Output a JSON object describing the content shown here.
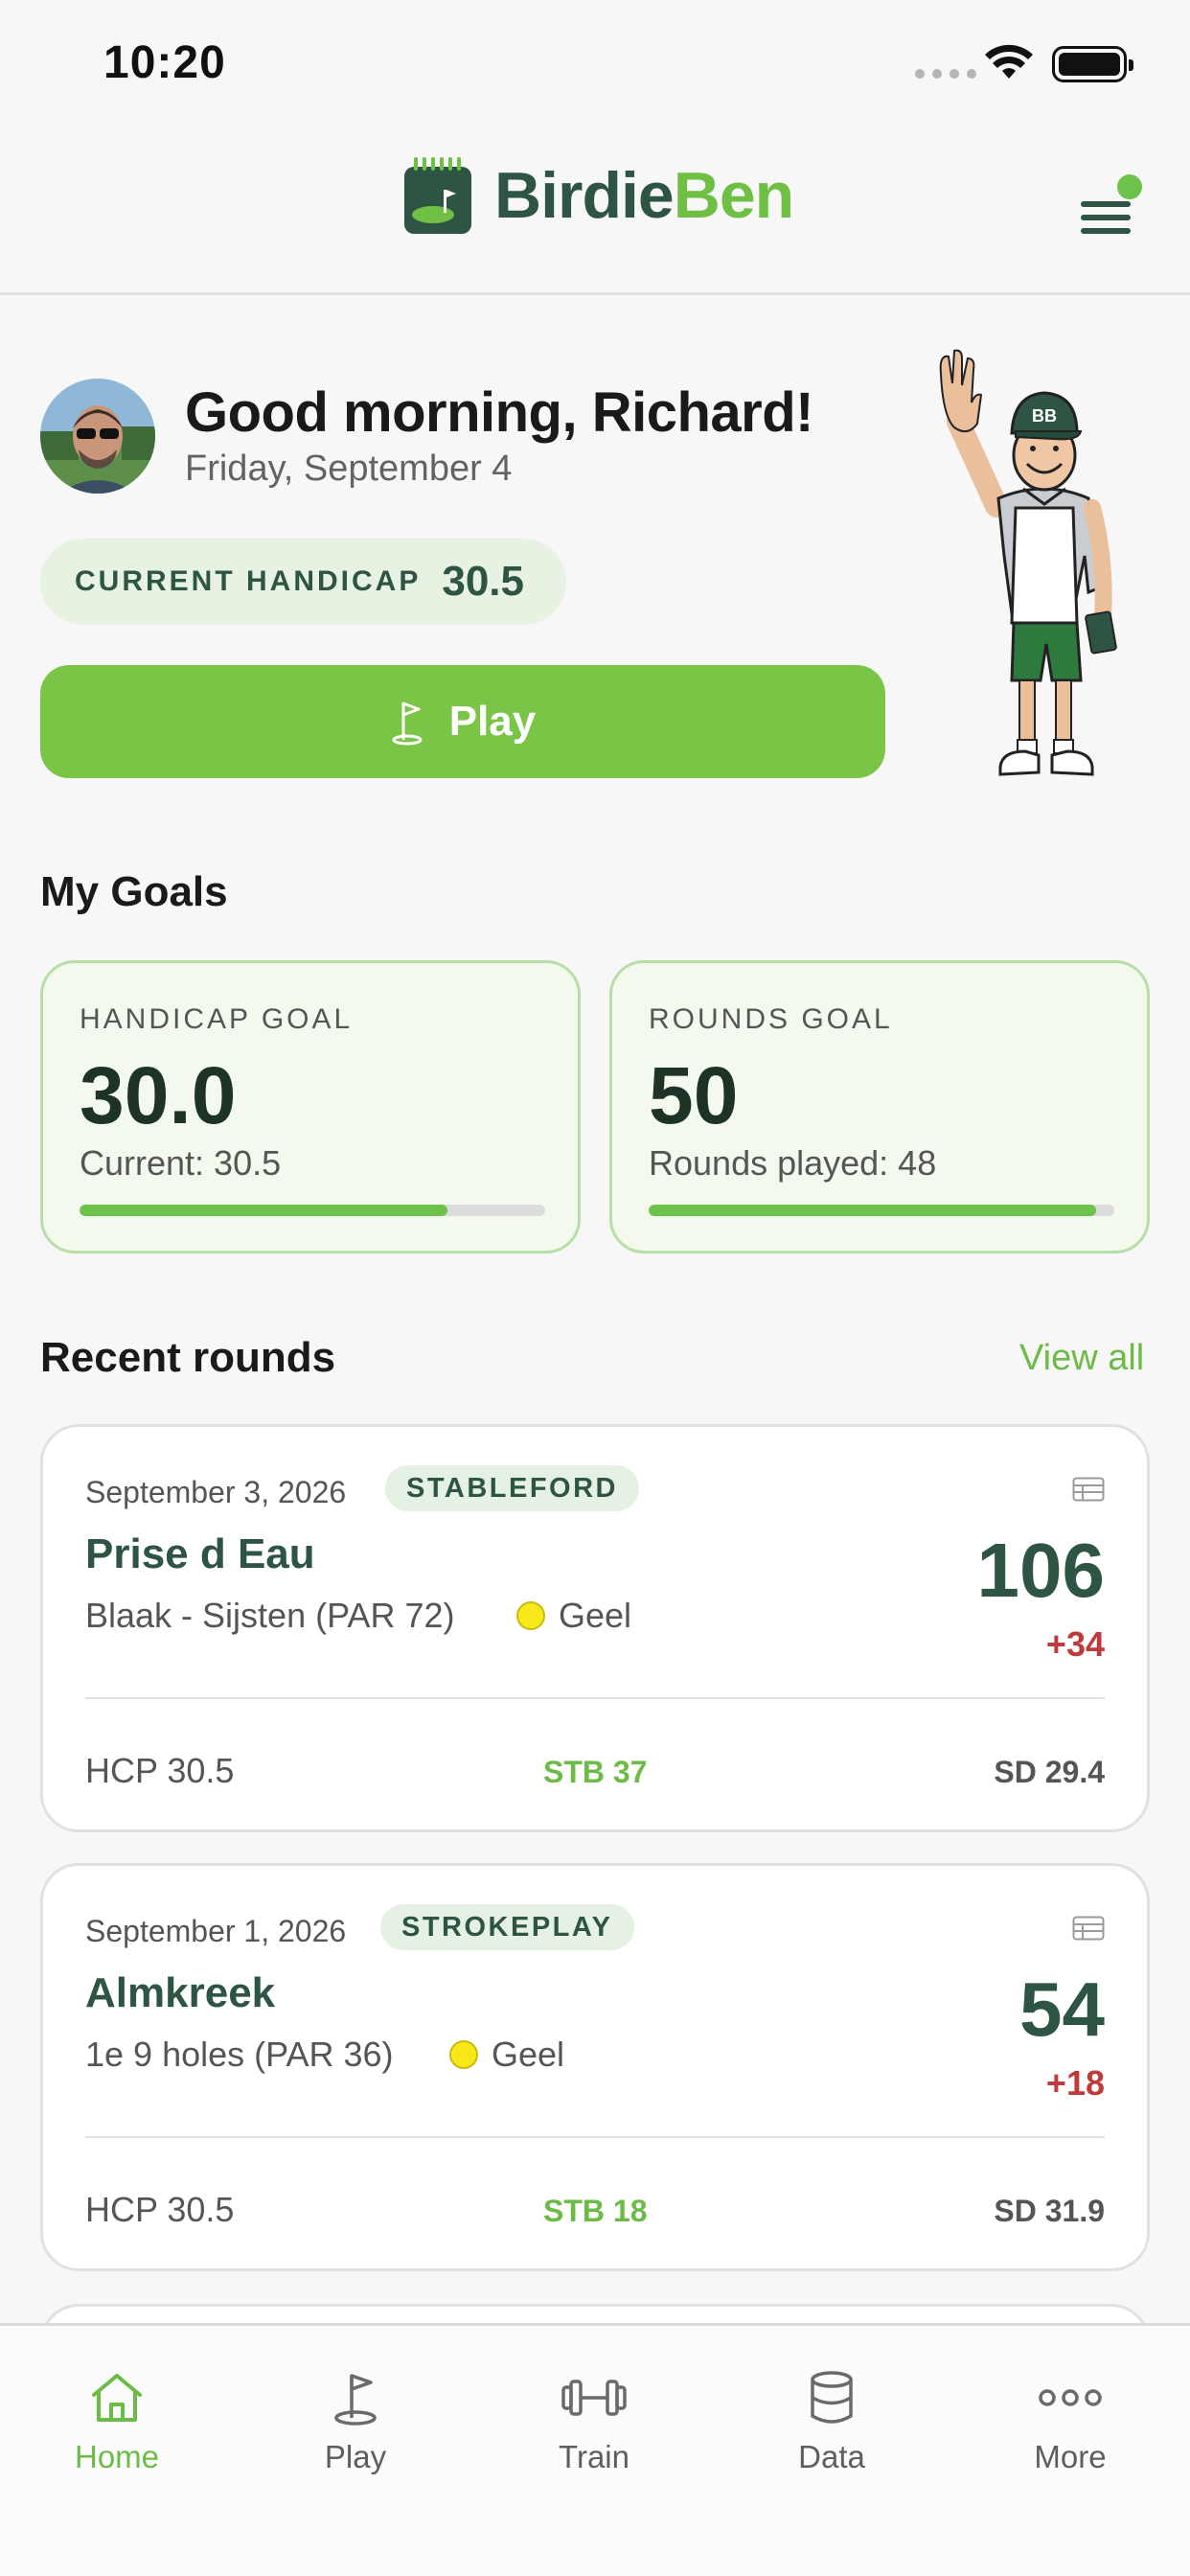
{
  "status_bar": {
    "time": "10:20"
  },
  "header": {
    "brand_part1": "Birdie",
    "brand_part2": "Ben"
  },
  "greeting": {
    "title": "Good morning, Richard!",
    "date": "Friday, September 4"
  },
  "handicap": {
    "label": "CURRENT HANDICAP",
    "value": "30.5"
  },
  "play_button": {
    "label": "Play"
  },
  "goals": {
    "title": "My Goals",
    "items": [
      {
        "label": "HANDICAP GOAL",
        "value": "30.0",
        "sub": "Current: 30.5",
        "progress": 0.79
      },
      {
        "label": "ROUNDS GOAL",
        "value": "50",
        "sub": "Rounds played: 48",
        "progress": 0.96
      }
    ]
  },
  "recent_rounds": {
    "title": "Recent rounds",
    "view_all": "View all",
    "rounds": [
      {
        "date": "September 3, 2026",
        "format": "STABLEFORD",
        "course": "Prise d Eau",
        "layout": "Blaak - Sijsten (PAR 72)",
        "tee": "Geel",
        "score": "106",
        "delta": "+34",
        "hcp": "HCP 30.5",
        "stb": "STB 37",
        "sd": "SD 29.4"
      },
      {
        "date": "September 1, 2026",
        "format": "STROKEPLAY",
        "course": "Almkreek",
        "layout": "1e 9 holes (PAR 36)",
        "tee": "Geel",
        "score": "54",
        "delta": "+18",
        "hcp": "HCP 30.5",
        "stb": "STB 18",
        "sd": "SD 31.9"
      }
    ]
  },
  "tabbar": {
    "tabs": [
      {
        "label": "Home",
        "icon": "home-icon",
        "active": true
      },
      {
        "label": "Play",
        "icon": "flag-icon"
      },
      {
        "label": "Train",
        "icon": "dumbbell-icon"
      },
      {
        "label": "Data",
        "icon": "database-icon"
      },
      {
        "label": "More",
        "icon": "more-icon"
      }
    ]
  },
  "colors": {
    "brand_dark": "#2e5544",
    "brand_green": "#6fbf44",
    "play_button": "#7bc546",
    "negative": "#bf3a3a",
    "tee_yellow": "#f7e81a"
  }
}
